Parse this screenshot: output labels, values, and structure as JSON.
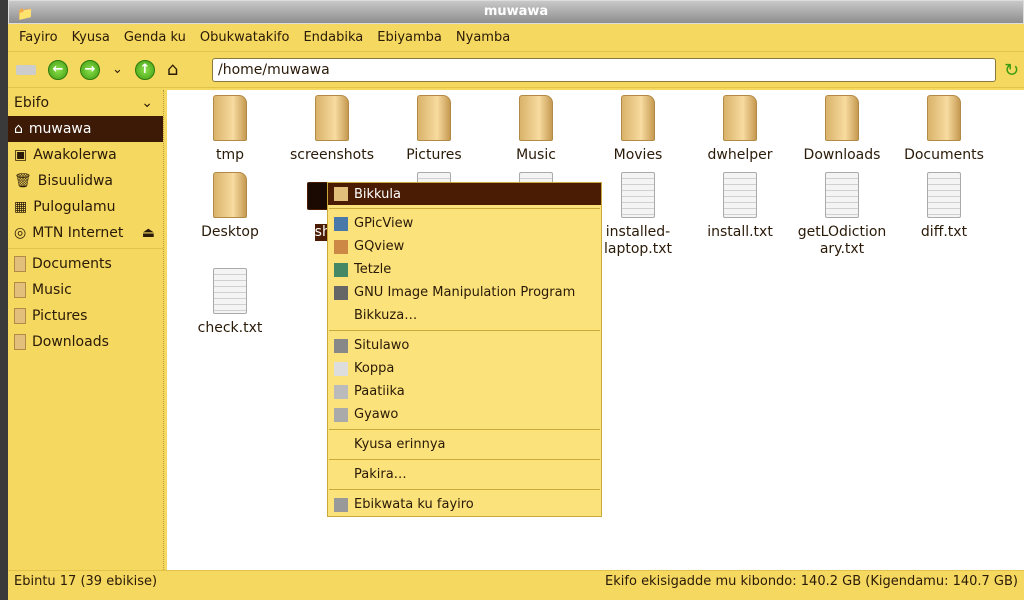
{
  "window": {
    "title": "muwawa"
  },
  "menubar": [
    "Fayiro",
    "Kyusa",
    "Genda ku",
    "Obukwatakifo",
    "Endabika",
    "Ebiyamba",
    "Nyamba"
  ],
  "toolbar": {
    "address": "/home/muwawa"
  },
  "sidebar": {
    "header": "Ebifo",
    "places": [
      {
        "label": "muwawa",
        "icon": "home-icon"
      },
      {
        "label": "Awakolerwa",
        "icon": "desktop-icon"
      },
      {
        "label": "Bisuulidwa",
        "icon": "trash-icon"
      },
      {
        "label": "Pulogulamu",
        "icon": "applications-icon"
      },
      {
        "label": "MTN Internet",
        "icon": "disc-icon"
      }
    ],
    "bookmarks": [
      "Documents",
      "Music",
      "Pictures",
      "Downloads"
    ]
  },
  "files": [
    {
      "name": "tmp",
      "type": "folder"
    },
    {
      "name": "screenshots",
      "type": "folder"
    },
    {
      "name": "Pictures",
      "type": "folder"
    },
    {
      "name": "Music",
      "type": "folder"
    },
    {
      "name": "Movies",
      "type": "folder"
    },
    {
      "name": "dwhelper",
      "type": "folder"
    },
    {
      "name": "Downloads",
      "type": "folder"
    },
    {
      "name": "Documents",
      "type": "folder"
    },
    {
      "name": "Desktop",
      "type": "folder"
    },
    {
      "name": "shot.",
      "type": "image"
    },
    {
      "name": "",
      "type": "doc"
    },
    {
      "name": "",
      "type": "doc"
    },
    {
      "name": "installed-\nlaptop.txt",
      "type": "doc"
    },
    {
      "name": "install.txt",
      "type": "doc"
    },
    {
      "name": "getLOdiction\nary.txt",
      "type": "doc"
    },
    {
      "name": "diff.txt",
      "type": "doc"
    },
    {
      "name": "check.txt",
      "type": "doc"
    }
  ],
  "context_menu": {
    "groups": [
      [
        {
          "label": "Bikkula",
          "icon": "folder-icon",
          "hl": true
        }
      ],
      [
        {
          "label": "GPicView",
          "icon": "gpicview-icon"
        },
        {
          "label": "GQview",
          "icon": "gqview-icon"
        },
        {
          "label": "Tetzle",
          "icon": "tetzle-icon"
        },
        {
          "label": "GNU Image Manipulation Program",
          "icon": "gimp-icon"
        },
        {
          "label": "Bikkuza…",
          "icon": ""
        }
      ],
      [
        {
          "label": "Situlawo",
          "icon": "cut-icon"
        },
        {
          "label": "Koppa",
          "icon": "copy-icon"
        },
        {
          "label": "Paatiika",
          "icon": "paste-icon"
        },
        {
          "label": "Gyawo",
          "icon": "delete-icon"
        }
      ],
      [
        {
          "label": "Kyusa erinnya",
          "icon": ""
        }
      ],
      [
        {
          "label": "Pakira…",
          "icon": ""
        }
      ],
      [
        {
          "label": "Ebikwata ku fayiro",
          "icon": "properties-icon"
        }
      ]
    ]
  },
  "status": {
    "left": "Ebintu 17 (39 ebikise)",
    "right": "Ekifo ekisigadde mu kibondo: 140.2 GB (Kigendamu: 140.7 GB)"
  }
}
